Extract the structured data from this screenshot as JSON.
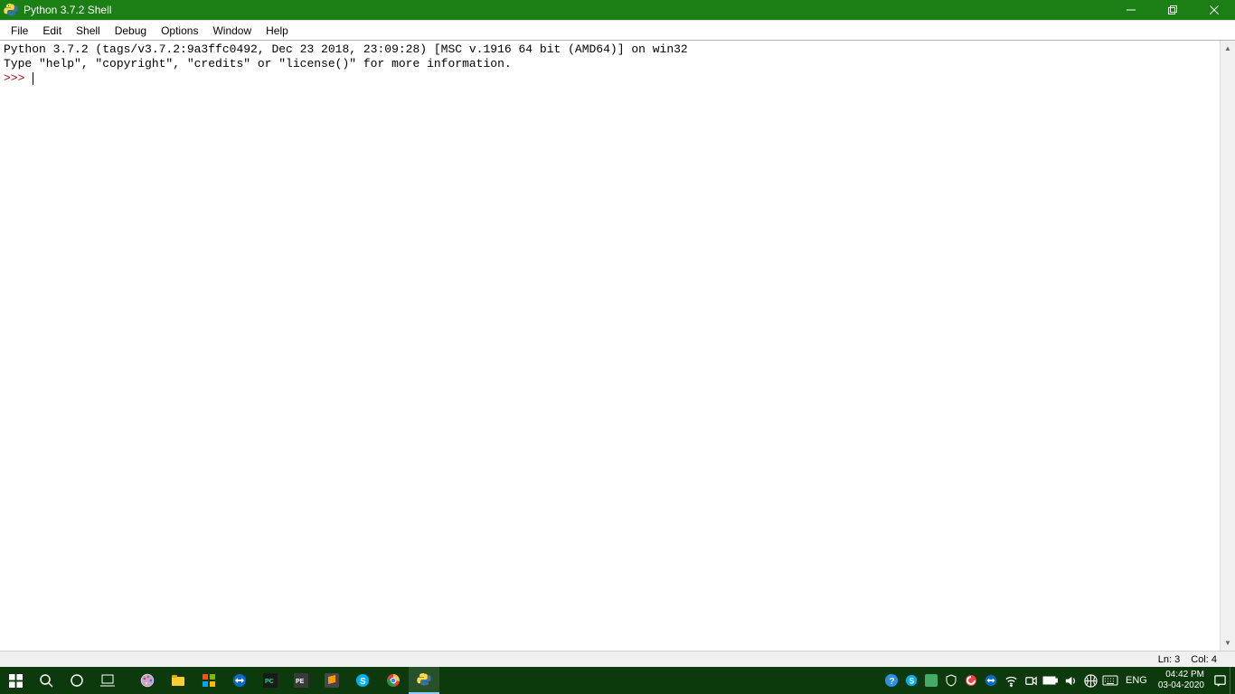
{
  "title": "Python 3.7.2 Shell",
  "menu": [
    "File",
    "Edit",
    "Shell",
    "Debug",
    "Options",
    "Window",
    "Help"
  ],
  "shell": {
    "line1": "Python 3.7.2 (tags/v3.7.2:9a3ffc0492, Dec 23 2018, 23:09:28) [MSC v.1916 64 bit (AMD64)] on win32",
    "line2": "Type \"help\", \"copyright\", \"credits\" or \"license()\" for more information.",
    "prompt": ">>> "
  },
  "status": {
    "ln": "Ln: 3",
    "col": "Col: 4"
  },
  "taskbar": {
    "lang": "ENG",
    "time": "04:42 PM",
    "date": "03-04-2020"
  }
}
